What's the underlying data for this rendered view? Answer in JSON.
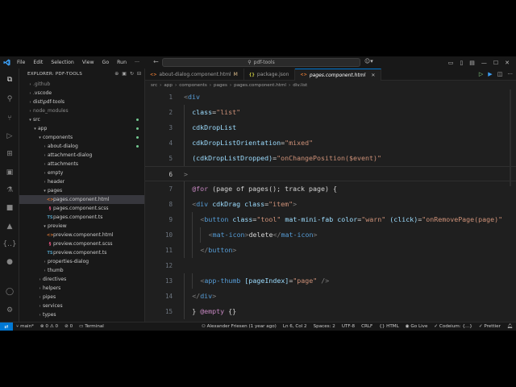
{
  "titlebar": {
    "menus": [
      "File",
      "Edit",
      "Selection",
      "View",
      "Go",
      "Run",
      "···"
    ],
    "search": "pdf-tools"
  },
  "sidebar": {
    "title": "EXPLORER: PDF-TOOLS",
    "items": [
      {
        "label": ".github",
        "kind": "folder",
        "depth": 1,
        "dim": true
      },
      {
        "label": ".vscode",
        "kind": "folder",
        "depth": 1
      },
      {
        "label": "dist\\pdf-tools",
        "kind": "folder",
        "depth": 1
      },
      {
        "label": "node_modules",
        "kind": "folder",
        "depth": 1,
        "dim": true
      },
      {
        "label": "src",
        "kind": "folder-open",
        "depth": 1,
        "mod": true
      },
      {
        "label": "app",
        "kind": "folder-open",
        "depth": 2,
        "mod": true
      },
      {
        "label": "components",
        "kind": "folder-open",
        "depth": 3,
        "mod": true
      },
      {
        "label": "about-dialog",
        "kind": "folder",
        "depth": 4,
        "mod": true
      },
      {
        "label": "attachment-dialog",
        "kind": "folder",
        "depth": 4
      },
      {
        "label": "attachments",
        "kind": "folder",
        "depth": 4
      },
      {
        "label": "empty",
        "kind": "folder",
        "depth": 4
      },
      {
        "label": "header",
        "kind": "folder",
        "depth": 4
      },
      {
        "label": "pages",
        "kind": "folder-open",
        "depth": 4
      },
      {
        "label": "pages.component.html",
        "kind": "html",
        "depth": 5,
        "selected": true
      },
      {
        "label": "pages.component.scss",
        "kind": "scss",
        "depth": 5
      },
      {
        "label": "pages.component.ts",
        "kind": "ts",
        "depth": 5
      },
      {
        "label": "preview",
        "kind": "folder-open",
        "depth": 4
      },
      {
        "label": "preview.component.html",
        "kind": "html",
        "depth": 5
      },
      {
        "label": "preview.component.scss",
        "kind": "scss",
        "depth": 5
      },
      {
        "label": "preview.component.ts",
        "kind": "ts",
        "depth": 5
      },
      {
        "label": "properties-dialog",
        "kind": "folder",
        "depth": 4
      },
      {
        "label": "thumb",
        "kind": "folder",
        "depth": 4
      },
      {
        "label": "directives",
        "kind": "folder",
        "depth": 3
      },
      {
        "label": "helpers",
        "kind": "folder",
        "depth": 3
      },
      {
        "label": "pipes",
        "kind": "folder",
        "depth": 3
      },
      {
        "label": "services",
        "kind": "folder",
        "depth": 3
      },
      {
        "label": "types",
        "kind": "folder",
        "depth": 3
      }
    ]
  },
  "tabs": [
    {
      "label": "about-dialog.component.html",
      "badge": "M",
      "icon": "html"
    },
    {
      "label": "package.json",
      "icon": "json"
    },
    {
      "label": "pages.component.html",
      "icon": "html",
      "active": true
    }
  ],
  "breadcrumb": [
    "src",
    "app",
    "components",
    "pages",
    "pages.component.html",
    "div.list"
  ],
  "code": {
    "current_line": 6,
    "lines": [
      {
        "n": 1,
        "indent": 0,
        "tokens": [
          {
            "c": "p",
            "v": "<"
          },
          {
            "c": "t",
            "v": "div"
          }
        ]
      },
      {
        "n": 2,
        "indent": 1,
        "tokens": [
          {
            "c": "a",
            "v": "class"
          },
          {
            "c": "d",
            "v": "="
          },
          {
            "c": "s",
            "v": "\"list\""
          }
        ]
      },
      {
        "n": 3,
        "indent": 1,
        "tokens": [
          {
            "c": "a",
            "v": "cdkDropList"
          }
        ]
      },
      {
        "n": 4,
        "indent": 1,
        "tokens": [
          {
            "c": "a",
            "v": "cdkDropListOrientation"
          },
          {
            "c": "d",
            "v": "="
          },
          {
            "c": "s",
            "v": "\"mixed\""
          }
        ]
      },
      {
        "n": 5,
        "indent": 1,
        "tokens": [
          {
            "c": "a",
            "v": "(cdkDropListDropped)"
          },
          {
            "c": "d",
            "v": "="
          },
          {
            "c": "s",
            "v": "\"onChangePosition($event)\""
          }
        ]
      },
      {
        "n": 6,
        "indent": 0,
        "tokens": [
          {
            "c": "p",
            "v": ">"
          }
        ]
      },
      {
        "n": 7,
        "indent": 1,
        "tokens": [
          {
            "c": "k",
            "v": "@for"
          },
          {
            "c": "d",
            "v": " (page of pages(); track page) {"
          }
        ]
      },
      {
        "n": 8,
        "indent": 1,
        "tokens": [
          {
            "c": "p",
            "v": "<"
          },
          {
            "c": "t",
            "v": "div"
          },
          {
            "c": "d",
            "v": " "
          },
          {
            "c": "a",
            "v": "cdkDrag"
          },
          {
            "c": "d",
            "v": " "
          },
          {
            "c": "a",
            "v": "class"
          },
          {
            "c": "d",
            "v": "="
          },
          {
            "c": "s",
            "v": "\"item\""
          },
          {
            "c": "p",
            "v": ">"
          }
        ]
      },
      {
        "n": 9,
        "indent": 2,
        "tokens": [
          {
            "c": "p",
            "v": "<"
          },
          {
            "c": "t",
            "v": "button"
          },
          {
            "c": "d",
            "v": " "
          },
          {
            "c": "a",
            "v": "class"
          },
          {
            "c": "d",
            "v": "="
          },
          {
            "c": "s",
            "v": "\"tool\""
          },
          {
            "c": "d",
            "v": " "
          },
          {
            "c": "a",
            "v": "mat-mini-fab"
          },
          {
            "c": "d",
            "v": " "
          },
          {
            "c": "a",
            "v": "color"
          },
          {
            "c": "d",
            "v": "="
          },
          {
            "c": "s",
            "v": "\"warn\""
          },
          {
            "c": "d",
            "v": " "
          },
          {
            "c": "a",
            "v": "(click)"
          },
          {
            "c": "d",
            "v": "="
          },
          {
            "c": "s",
            "v": "\"onRemovePage(page)\""
          }
        ]
      },
      {
        "n": 10,
        "indent": 3,
        "tokens": [
          {
            "c": "p",
            "v": "<"
          },
          {
            "c": "t",
            "v": "mat-icon"
          },
          {
            "c": "p",
            "v": ">"
          },
          {
            "c": "d",
            "v": "delete"
          },
          {
            "c": "p",
            "v": "</"
          },
          {
            "c": "t",
            "v": "mat-icon"
          },
          {
            "c": "p",
            "v": ">"
          }
        ]
      },
      {
        "n": 11,
        "indent": 2,
        "tokens": [
          {
            "c": "p",
            "v": "</"
          },
          {
            "c": "t",
            "v": "button"
          },
          {
            "c": "p",
            "v": ">"
          }
        ]
      },
      {
        "n": 12,
        "indent": 0,
        "tokens": []
      },
      {
        "n": 13,
        "indent": 2,
        "tokens": [
          {
            "c": "p",
            "v": "<"
          },
          {
            "c": "t",
            "v": "app-thumb"
          },
          {
            "c": "d",
            "v": " "
          },
          {
            "c": "a",
            "v": "[pageIndex]"
          },
          {
            "c": "d",
            "v": "="
          },
          {
            "c": "s",
            "v": "\"page\""
          },
          {
            "c": "d",
            "v": " "
          },
          {
            "c": "p",
            "v": "/>"
          }
        ]
      },
      {
        "n": 14,
        "indent": 1,
        "tokens": [
          {
            "c": "p",
            "v": "</"
          },
          {
            "c": "t",
            "v": "div"
          },
          {
            "c": "p",
            "v": ">"
          }
        ]
      },
      {
        "n": 15,
        "indent": 1,
        "tokens": [
          {
            "c": "d",
            "v": "} "
          },
          {
            "c": "k",
            "v": "@empty"
          },
          {
            "c": "d",
            "v": " {}"
          }
        ]
      }
    ]
  },
  "statusbar": {
    "branch": "main*",
    "errors": "0",
    "warnings": "0",
    "ports": "0",
    "terminal": "Terminal",
    "blame": "Alexander Friesen (1 year ago)",
    "position": "Ln 6, Col 2",
    "spaces": "Spaces: 2",
    "encoding": "UTF-8",
    "eol": "CRLF",
    "language": "HTML",
    "golive": "Go Live",
    "codeium": "Codeium: {...}",
    "prettier": "Prettier"
  },
  "colors": {
    "accent": "#0078d4",
    "background": "#1f1f1f",
    "sidebar": "#181818"
  }
}
